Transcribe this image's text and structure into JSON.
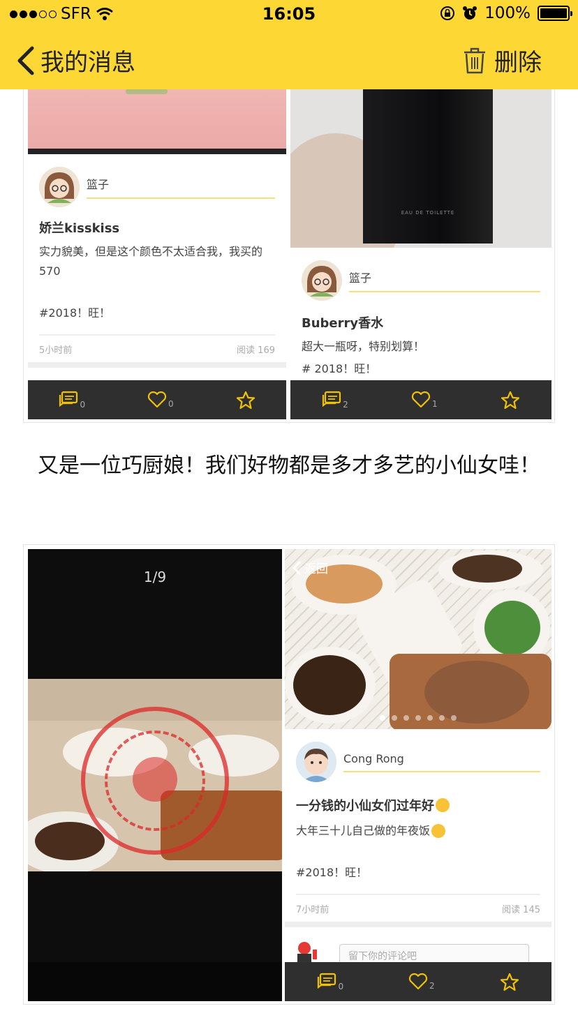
{
  "status_bar": {
    "carrier": "SFR",
    "time": "16:05",
    "battery": "100%"
  },
  "nav": {
    "title": "我的消息",
    "delete_label": "删除"
  },
  "section1": {
    "left": {
      "user": "篮子",
      "title": "娇兰kisskiss",
      "body": "实力貌美，但是这个颜色不太适合我，我买的570",
      "tag": "#2018！旺！",
      "time": "5小时前",
      "reads": "阅读 169",
      "comments": "0",
      "likes": "0"
    },
    "right": {
      "bottle_text": "EAU DE TOILETTE",
      "user": "篮子",
      "title": "Buberry香水",
      "body": "超大一瓶呀，特别划算！",
      "tag": "# 2018！旺！",
      "comments": "2",
      "likes": "1"
    }
  },
  "caption": "又是一位巧厨娘！我们好物都是多才多艺的小仙女哇！",
  "section2": {
    "left": {
      "counter": "1/9"
    },
    "right": {
      "back_label": "返回",
      "user": "Cong Rong",
      "title": "一分钱的小仙女们过年好",
      "body": "大年三十儿自己做的年夜饭",
      "tag": "#2018！旺！",
      "time": "7小时前",
      "reads": "阅读 145",
      "comment_placeholder": "留下你的评论吧",
      "comments": "0",
      "likes": "2"
    }
  },
  "colors": {
    "brand_yellow": "#fdd835",
    "footer_dark": "#2f2f2f",
    "icon_yellow": "#f2c200"
  }
}
